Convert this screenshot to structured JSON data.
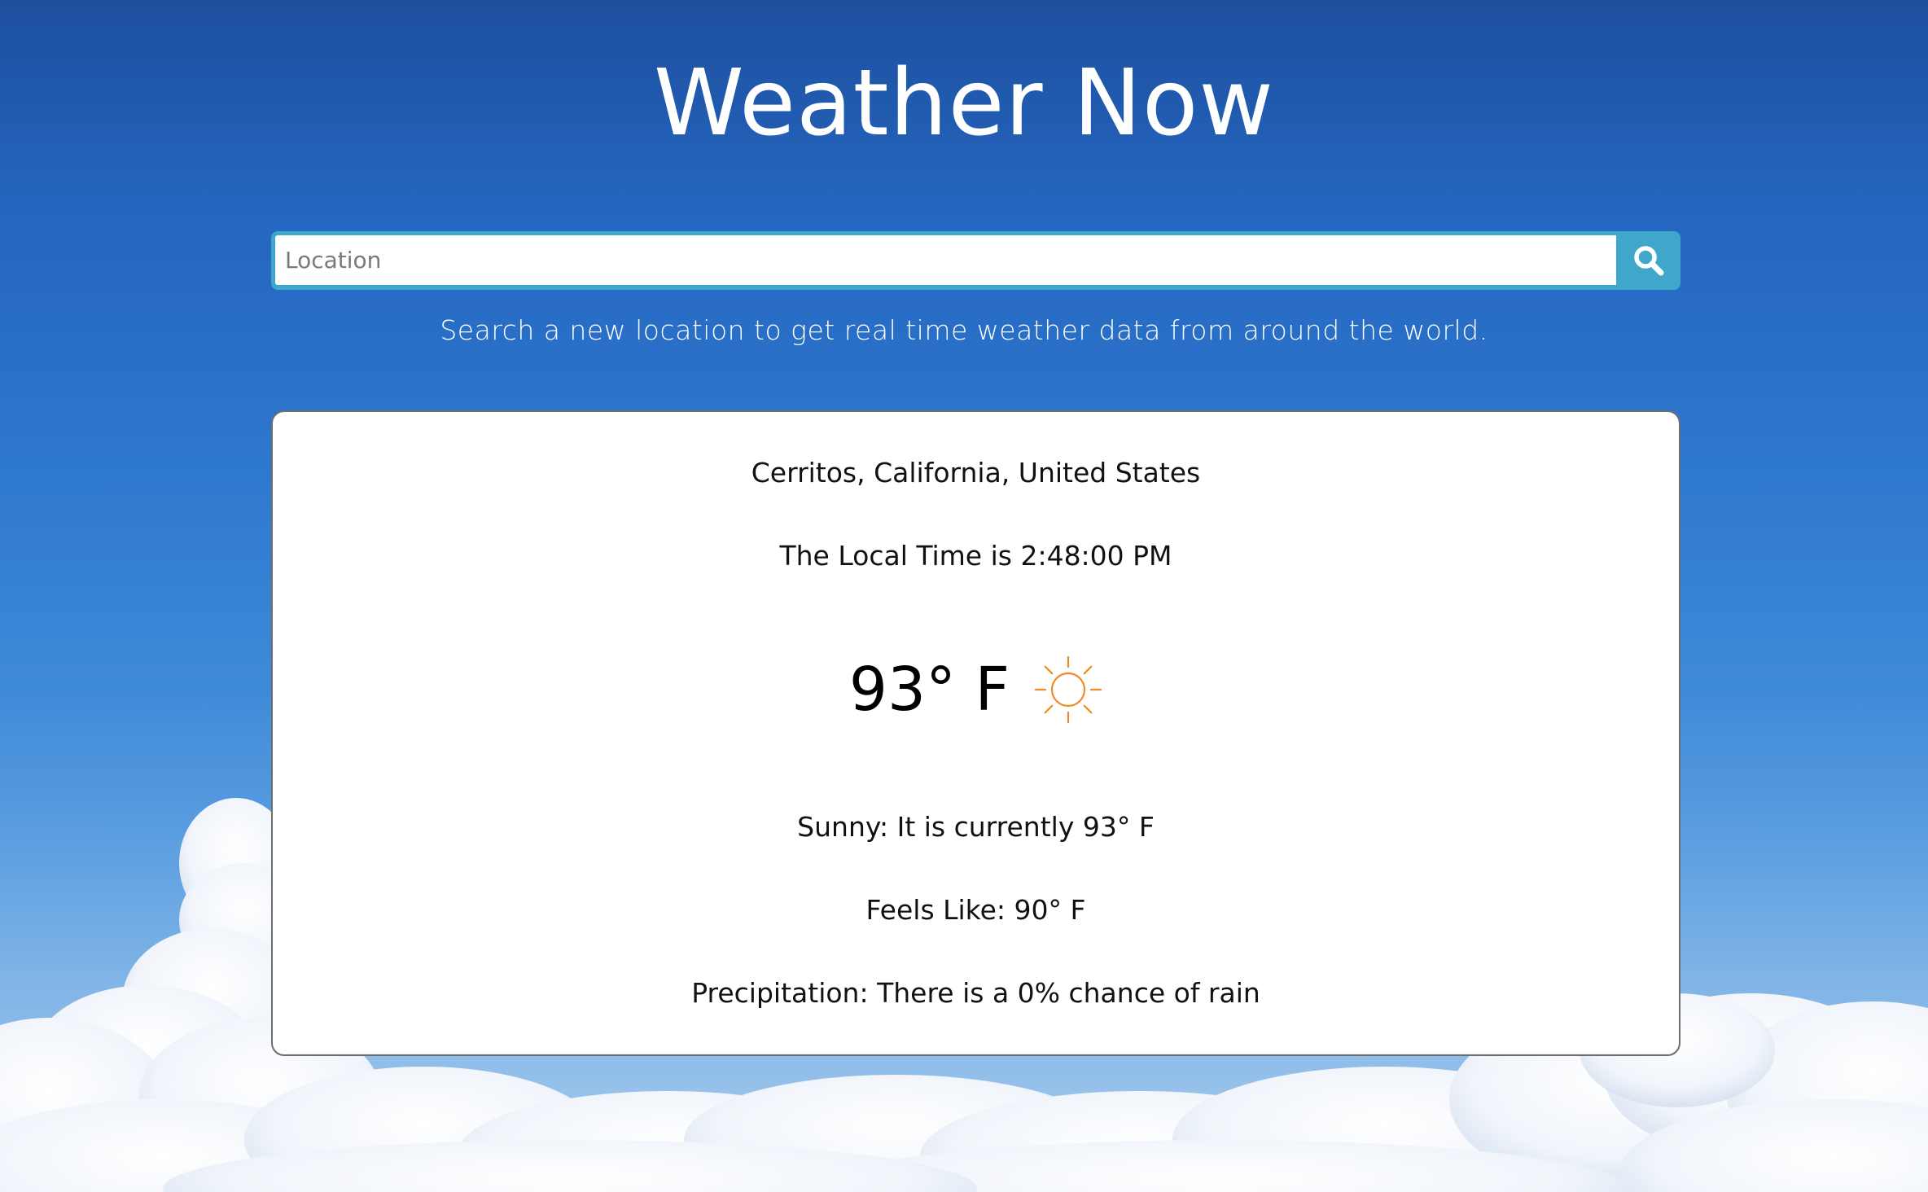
{
  "app": {
    "title": "Weather Now"
  },
  "search": {
    "placeholder": "Location",
    "value": "",
    "hint": "Search a new location to get real time weather data from around the world.",
    "button_icon": "search-icon"
  },
  "weather": {
    "location": "Cerritos, California, United States",
    "local_time": "The Local Time is 2:48:00 PM",
    "temperature": "93° F",
    "condition_icon": "sun-icon",
    "condition": "Sunny: It is currently 93° F",
    "feels_like": "Feels Like: 90° F",
    "precipitation": "Precipitation: There is a 0% chance of rain"
  },
  "colors": {
    "accent": "#3fa7c9",
    "sun": "#f08a24",
    "sky_top": "#1d4f9e",
    "card_border": "#6d6d6d"
  }
}
